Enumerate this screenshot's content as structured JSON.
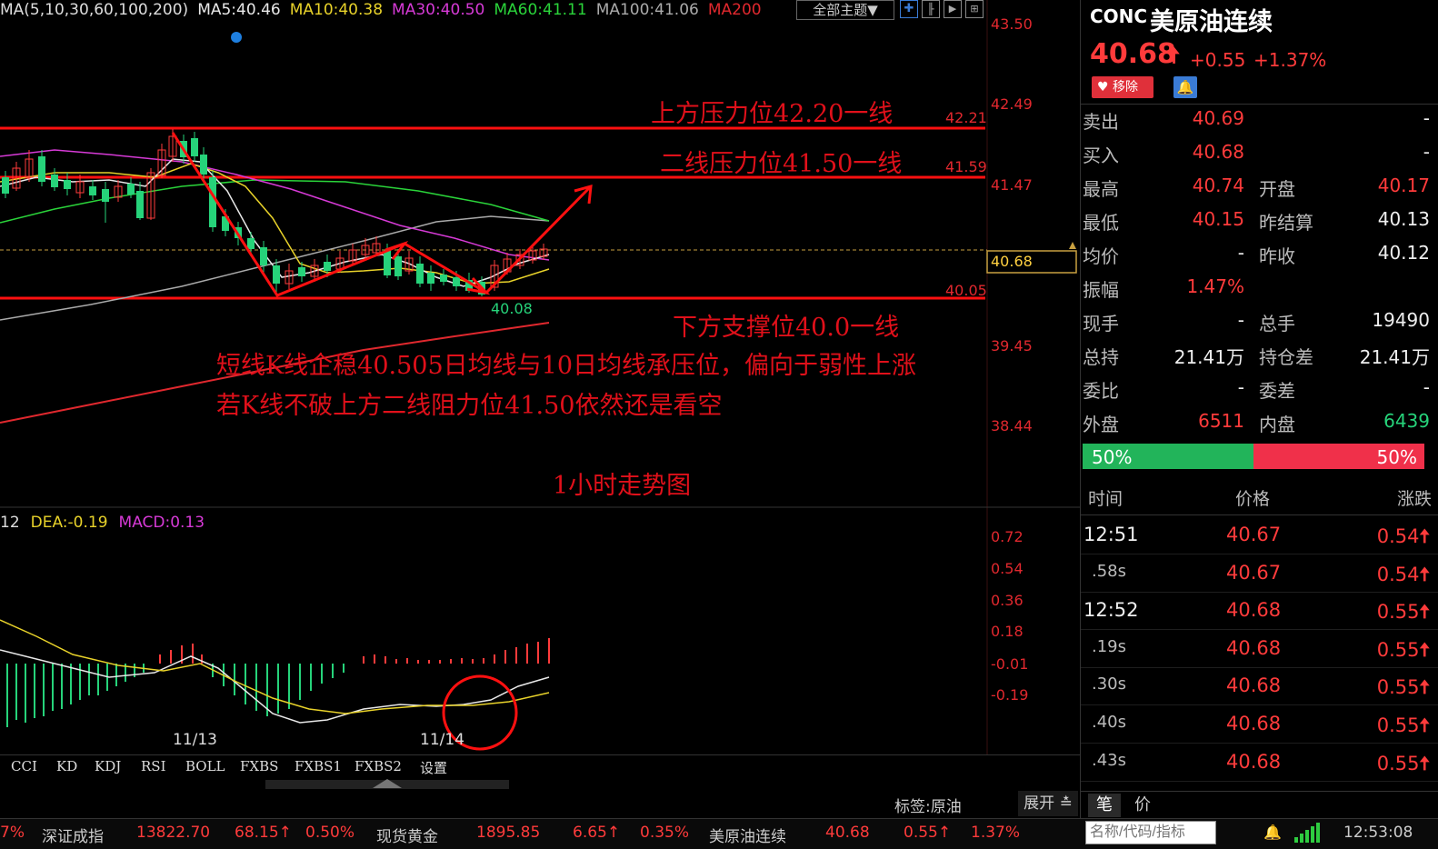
{
  "ma_legend": {
    "ma_header": "MA(5,10,30,60,100,200)",
    "ma5": "MA5:40.46",
    "ma10": "MA10:40.38",
    "ma30": "MA30:40.50",
    "ma60": "MA60:41.11",
    "ma100": "MA100:41.06",
    "ma200": "MA200"
  },
  "toolbar": {
    "theme_select": "全部主题▼"
  },
  "price_axis": [
    "43.50",
    "42.49",
    "41.47",
    "40.68",
    "39.45",
    "38.44"
  ],
  "level_labels": {
    "l1": "42.21",
    "l2": "41.59",
    "l3": "40.05",
    "low": "40.08"
  },
  "annotations": {
    "resistance1": "上方压力位42.20一线",
    "resistance2": "二线压力位41.50一线",
    "support": "下方支撑位40.0一线",
    "note1": "短线K线企稳40.505日均线与10日均线承压位，偏向于弱性上涨",
    "note2": "若K线不破上方二线阻力位41.50依然还是看空",
    "chart_title": "1小时走势图"
  },
  "macd_legend": {
    "dif": "12",
    "dea": "DEA:-0.19",
    "macd": "MACD:0.13"
  },
  "macd_axis": [
    "0.72",
    "0.54",
    "0.36",
    "0.18",
    "-0.01",
    "-0.19"
  ],
  "dates": [
    "11/13",
    "11/14"
  ],
  "indicator_tabs": [
    "CCI",
    "KD",
    "KDJ",
    "RSI",
    "BOLL",
    "FXBS",
    "FXBS1",
    "FXBS2",
    "设置"
  ],
  "status": {
    "tag": "标签:原油",
    "expand": "展开 ≛"
  },
  "quote": {
    "code": "CONC",
    "name": "美原油连续",
    "price": "40.68",
    "change": "+0.55",
    "change_pct": "+1.37%",
    "remove_btn": "移除",
    "rows": [
      {
        "k1": "卖出",
        "v1": "40.69",
        "k2": "",
        "v2": "-"
      },
      {
        "k1": "买入",
        "v1": "40.68",
        "k2": "",
        "v2": "-"
      },
      {
        "k1": "最高",
        "v1": "40.74",
        "k2": "开盘",
        "v2": "40.17"
      },
      {
        "k1": "最低",
        "v1": "40.15",
        "k2": "昨结算",
        "v2": "40.13"
      },
      {
        "k1": "均价",
        "v1": "-",
        "k2": "昨收",
        "v2": "40.12"
      },
      {
        "k1": "振幅",
        "v1": "1.47%",
        "k2": "",
        "v2": ""
      },
      {
        "k1": "现手",
        "v1": "-",
        "k2": "总手",
        "v2": "19490"
      },
      {
        "k1": "总持",
        "v1": "21.41万",
        "k2": "持仓差",
        "v2": "21.41万"
      },
      {
        "k1": "委比",
        "v1": "-",
        "k2": "委差",
        "v2": "-"
      },
      {
        "k1": "外盘",
        "v1": "6511",
        "k2": "内盘",
        "v2": "6439"
      }
    ],
    "ratio_left": "50%",
    "ratio_right": "50%"
  },
  "trades": {
    "headers": [
      "时间",
      "价格",
      "涨跌"
    ],
    "rows": [
      {
        "t": "12:51",
        "p": "40.67",
        "c": "0.54"
      },
      {
        "t": ".58s",
        "p": "40.67",
        "c": "0.54"
      },
      {
        "t": "12:52",
        "p": "40.68",
        "c": "0.55"
      },
      {
        "t": ".19s",
        "p": "40.68",
        "c": "0.55"
      },
      {
        "t": ".30s",
        "p": "40.68",
        "c": "0.55"
      },
      {
        "t": ".40s",
        "p": "40.68",
        "c": "0.55"
      },
      {
        "t": ".43s",
        "p": "40.68",
        "c": "0.55"
      }
    ]
  },
  "panel_tabs": {
    "tick": "笔",
    "price": "价"
  },
  "search": {
    "placeholder": "名称/代码/指标"
  },
  "ticker": {
    "edge_pct": "7%",
    "i1_name": "深证成指",
    "i1_val": "13822.70",
    "i1_chg": "68.15↑",
    "i1_pct": "0.50%",
    "i2_name": "现货黄金",
    "i2_val": "1895.85",
    "i2_chg": "6.65↑",
    "i2_pct": "0.35%",
    "i3_name": "美原油连续",
    "i3_val": "40.68",
    "i3_chg": "0.55↑",
    "i3_pct": "1.37%"
  },
  "clock": "12:53:08"
}
